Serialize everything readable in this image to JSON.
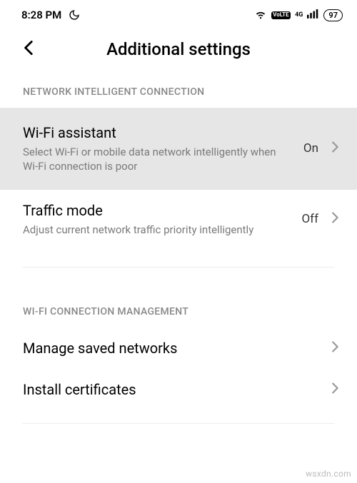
{
  "status": {
    "time": "8:28 PM",
    "dnd_icon": "moon",
    "wifi_icon": "wifi",
    "lte_label": "VoLTE",
    "signal_label": "4G",
    "battery": "97"
  },
  "header": {
    "title": "Additional settings",
    "back_icon": "chevron-left"
  },
  "sections": {
    "network": {
      "label": "NETWORK INTELLIGENT CONNECTION",
      "items": [
        {
          "title": "Wi-Fi assistant",
          "subtitle": "Select Wi-Fi or mobile data network intelligently when Wi-Fi connection is poor",
          "value": "On"
        },
        {
          "title": "Traffic mode",
          "subtitle": "Adjust current network traffic priority intelligently",
          "value": "Off"
        }
      ]
    },
    "wifi_mgmt": {
      "label": "WI-FI CONNECTION MANAGEMENT",
      "items": [
        {
          "title": "Manage saved networks"
        },
        {
          "title": "Install certificates"
        }
      ]
    }
  },
  "watermark": "wsxdn.com"
}
